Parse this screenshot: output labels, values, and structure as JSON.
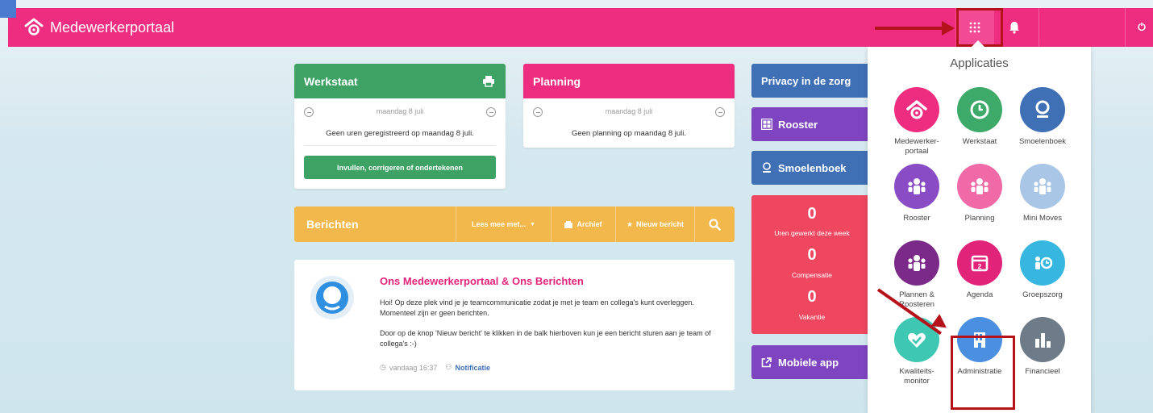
{
  "topbar": {
    "brand": "Medewerkerportaal",
    "colors": {
      "bar": "#ef2d80",
      "annotation": "#b5121b"
    }
  },
  "werkstaat": {
    "title": "Werkstaat",
    "date": "maandag 8 juli",
    "message": "Geen uren geregistreerd op maandag 8 juli.",
    "button": "Invullen, corrigeren of ondertekenen"
  },
  "planning": {
    "title": "Planning",
    "date": "maandag 8 juli",
    "message": "Geen planning op maandag 8 juli."
  },
  "side": {
    "privacy": "Privacy in de zorg",
    "rooster": "Rooster",
    "smoelenboek": "Smoelenboek",
    "stats": [
      {
        "value": "0",
        "label": "Uren gewerkt deze week"
      },
      {
        "value": "0",
        "label": "Compensatie"
      },
      {
        "value": "0",
        "label": "Vakantie"
      }
    ],
    "mobiele_app": "Mobiele app"
  },
  "berichten": {
    "title": "Berichten",
    "lees_mee": "Lees mee met...",
    "archief": "Archief",
    "nieuw_bericht": "Nieuw bericht"
  },
  "post": {
    "title": "Ons Medewerkerportaal & Ons Berichten",
    "para1": "Hoi! Op deze plek vind je je teamcommunicatie zodat je met je team en collega's kunt overleggen. Momenteel zijn er geen berichten.",
    "para2": "Door op de knop 'Nieuw bericht' te klikken in de balk hierboven kun je een bericht sturen aan je team of collega's :-)",
    "time": "vandaag 16:37",
    "tag": "Notificatie"
  },
  "apps": {
    "title": "Applicaties",
    "items": [
      {
        "label": "Medewerker-\nportaal",
        "color": "#ef2d80",
        "icon": "home-icon"
      },
      {
        "label": "Werkstaat",
        "color": "#3daa6a",
        "icon": "clock-icon"
      },
      {
        "label": "Smoelenboek",
        "color": "#3f6fb5",
        "icon": "person-icon"
      },
      {
        "label": "Rooster",
        "color": "#8a4cc4",
        "icon": "team-icon"
      },
      {
        "label": "Planning",
        "color": "#f06aa8",
        "icon": "team-icon"
      },
      {
        "label": "Mini Moves",
        "color": "#a9c6e6",
        "icon": "team-icon"
      },
      {
        "label": "Plannen &\nRoosteren",
        "color": "#7b2a8a",
        "icon": "team-icon"
      },
      {
        "label": "Agenda",
        "color": "#e2237a",
        "icon": "calendar-icon"
      },
      {
        "label": "Groepszorg",
        "color": "#37b7e0",
        "icon": "group-icon"
      },
      {
        "label": "Kwaliteits-\nmonitor",
        "color": "#3ec7b2",
        "icon": "heart-icon"
      },
      {
        "label": "Administratie",
        "color": "#4a8fe0",
        "icon": "building-icon"
      },
      {
        "label": "Financieel",
        "color": "#6e7c8a",
        "icon": "bar-chart-icon"
      }
    ]
  }
}
